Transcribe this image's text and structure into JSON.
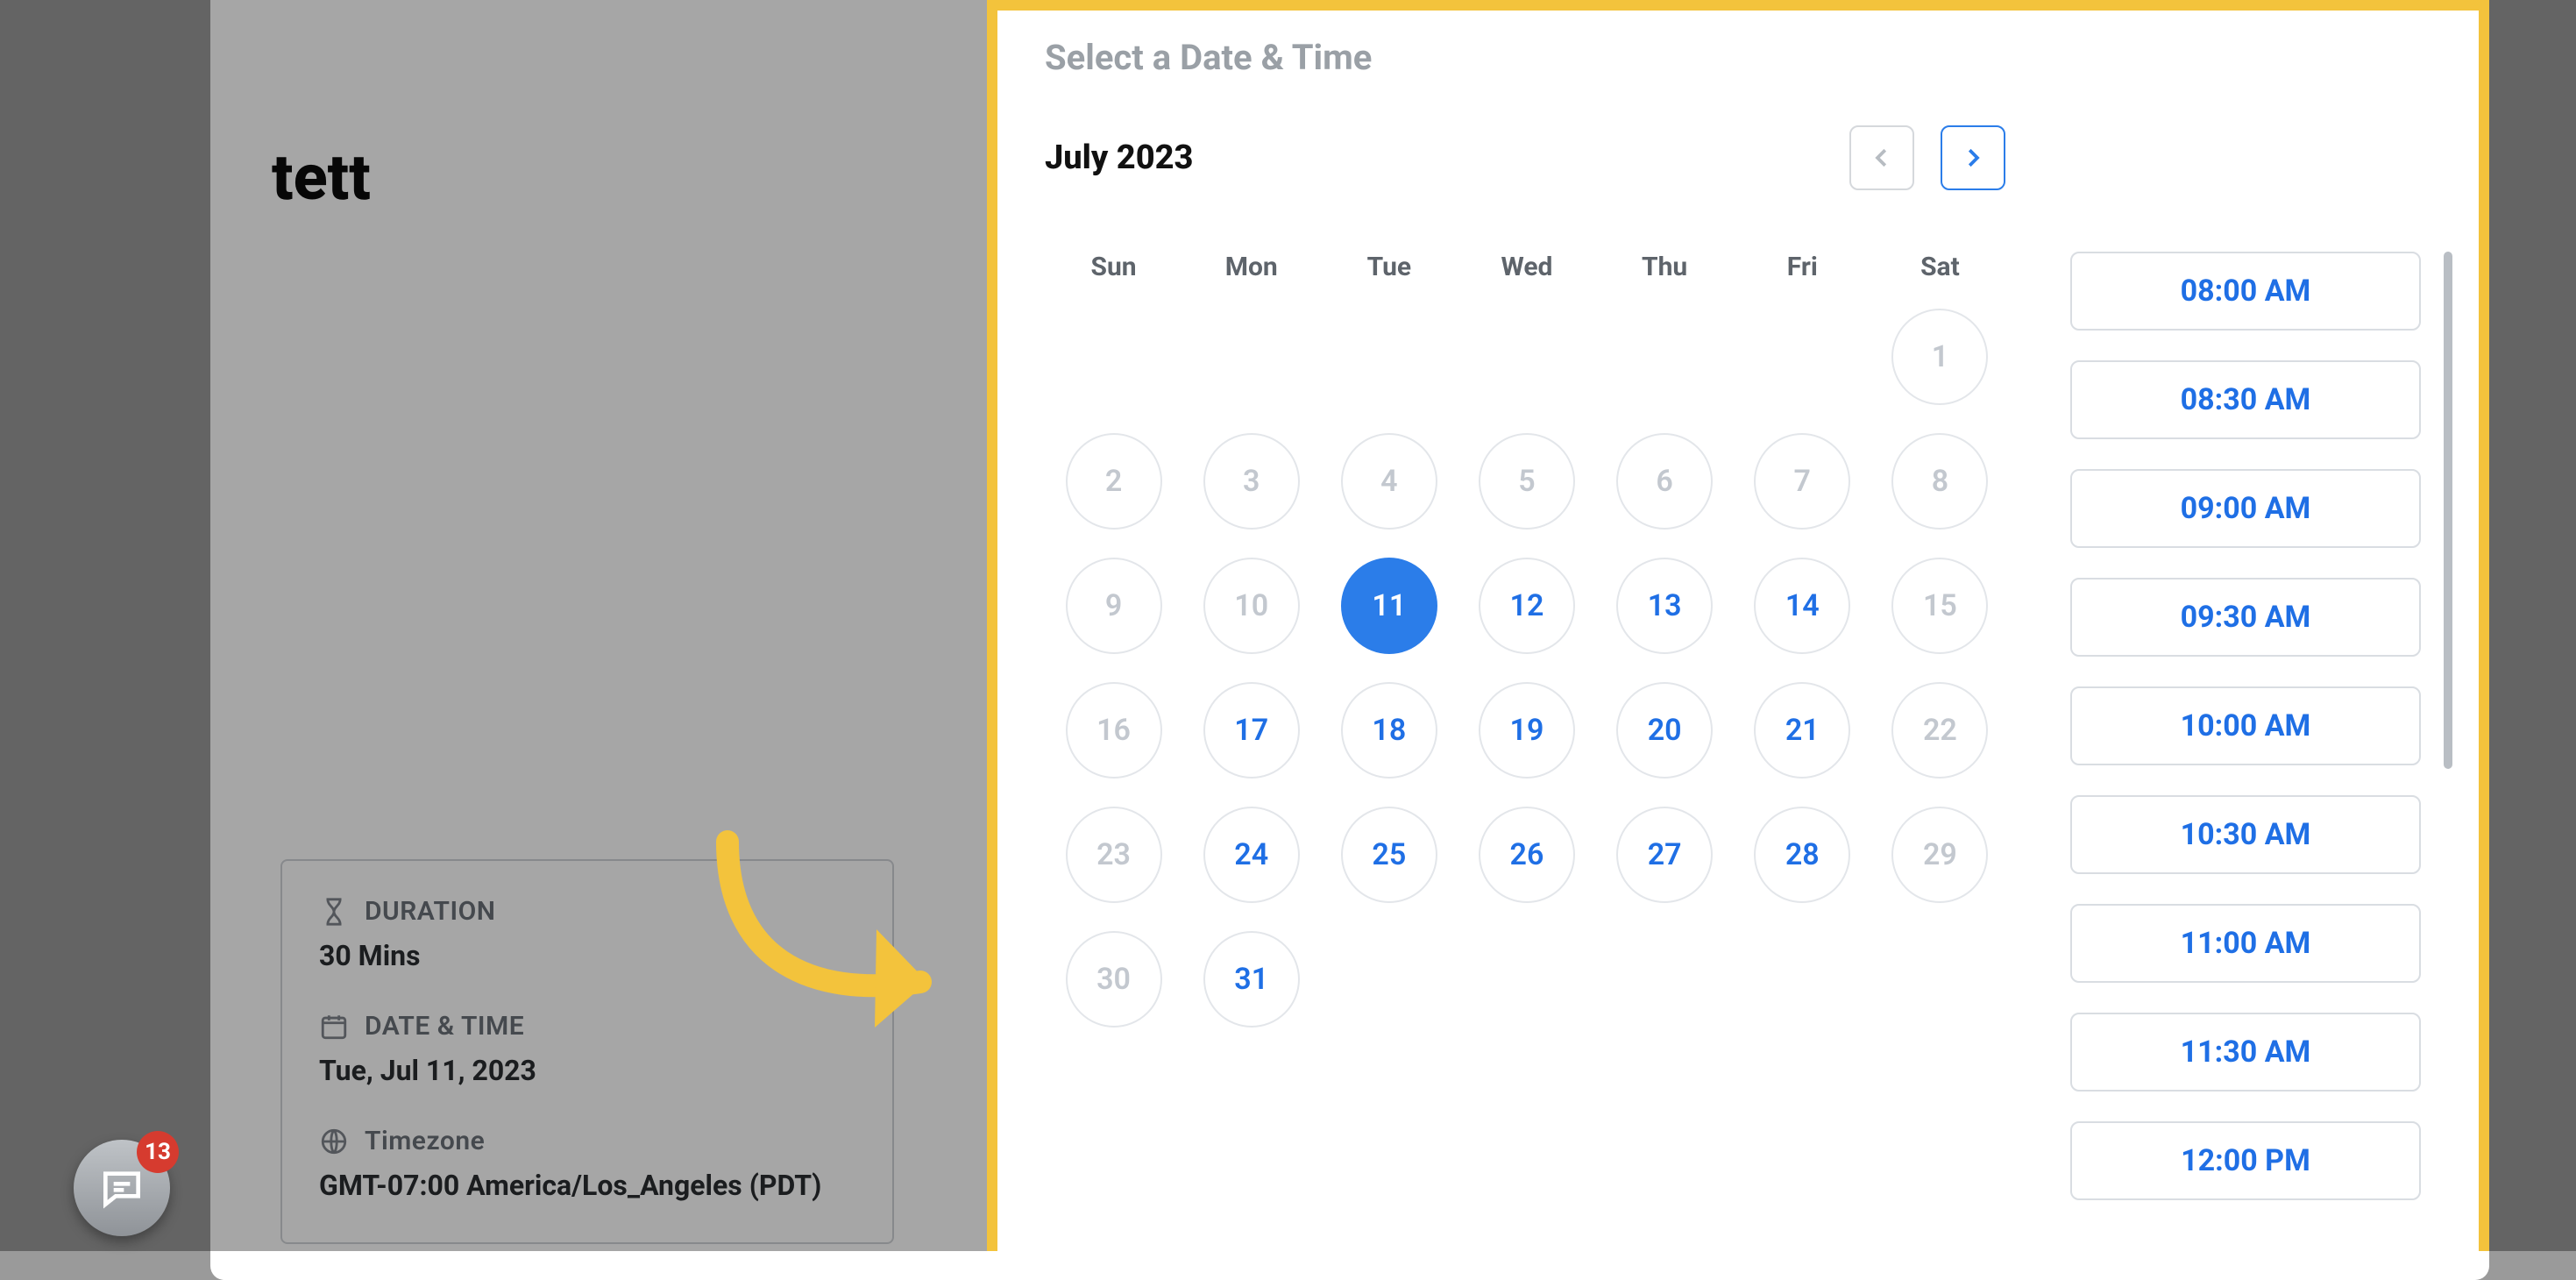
{
  "event": {
    "title": "tett"
  },
  "info": {
    "duration_label": "DURATION",
    "duration_value": "30 Mins",
    "datetime_label": "DATE & TIME",
    "datetime_value": "Tue, Jul 11, 2023",
    "timezone_label": "Timezone",
    "timezone_value": "GMT-07:00 America/Los_Angeles (PDT)"
  },
  "picker": {
    "title": "Select a Date & Time",
    "month": "July 2023",
    "prev_enabled": false,
    "next_enabled": true,
    "dow": [
      "Sun",
      "Mon",
      "Tue",
      "Wed",
      "Thu",
      "Fri",
      "Sat"
    ],
    "weeks": [
      [
        null,
        null,
        null,
        null,
        null,
        null,
        {
          "n": 1,
          "state": "disabled"
        }
      ],
      [
        {
          "n": 2,
          "state": "disabled"
        },
        {
          "n": 3,
          "state": "disabled"
        },
        {
          "n": 4,
          "state": "disabled"
        },
        {
          "n": 5,
          "state": "disabled"
        },
        {
          "n": 6,
          "state": "disabled"
        },
        {
          "n": 7,
          "state": "disabled"
        },
        {
          "n": 8,
          "state": "disabled"
        }
      ],
      [
        {
          "n": 9,
          "state": "disabled"
        },
        {
          "n": 10,
          "state": "disabled"
        },
        {
          "n": 11,
          "state": "selected"
        },
        {
          "n": 12,
          "state": "available"
        },
        {
          "n": 13,
          "state": "available"
        },
        {
          "n": 14,
          "state": "available"
        },
        {
          "n": 15,
          "state": "disabled"
        }
      ],
      [
        {
          "n": 16,
          "state": "disabled"
        },
        {
          "n": 17,
          "state": "available"
        },
        {
          "n": 18,
          "state": "available"
        },
        {
          "n": 19,
          "state": "available"
        },
        {
          "n": 20,
          "state": "available"
        },
        {
          "n": 21,
          "state": "available"
        },
        {
          "n": 22,
          "state": "disabled"
        }
      ],
      [
        {
          "n": 23,
          "state": "disabled"
        },
        {
          "n": 24,
          "state": "available"
        },
        {
          "n": 25,
          "state": "available"
        },
        {
          "n": 26,
          "state": "available"
        },
        {
          "n": 27,
          "state": "available"
        },
        {
          "n": 28,
          "state": "available"
        },
        {
          "n": 29,
          "state": "disabled"
        }
      ],
      [
        {
          "n": 30,
          "state": "disabled"
        },
        {
          "n": 31,
          "state": "available"
        },
        null,
        null,
        null,
        null,
        null
      ]
    ],
    "times": [
      "08:00 AM",
      "08:30 AM",
      "09:00 AM",
      "09:30 AM",
      "10:00 AM",
      "10:30 AM",
      "11:00 AM",
      "11:30 AM",
      "12:00 PM"
    ]
  },
  "chat": {
    "unread": "13"
  }
}
